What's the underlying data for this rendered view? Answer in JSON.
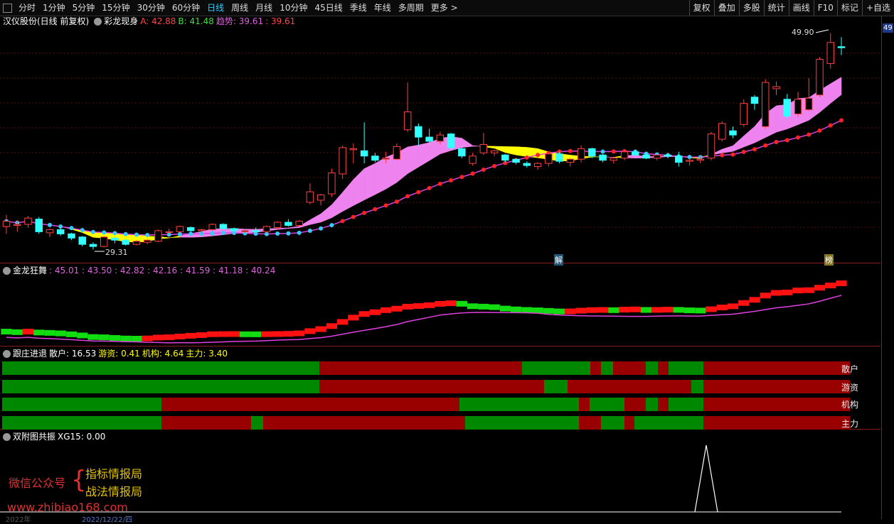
{
  "toolbar": {
    "periods": [
      {
        "label": "分时",
        "active": false
      },
      {
        "label": "1分钟",
        "active": false
      },
      {
        "label": "5分钟",
        "active": false
      },
      {
        "label": "15分钟",
        "active": false
      },
      {
        "label": "30分钟",
        "active": false
      },
      {
        "label": "60分钟",
        "active": false
      },
      {
        "label": "日线",
        "active": true
      },
      {
        "label": "周线",
        "active": false
      },
      {
        "label": "月线",
        "active": false
      },
      {
        "label": "10分钟",
        "active": false
      },
      {
        "label": "45日线",
        "active": false
      },
      {
        "label": "季线",
        "active": false
      },
      {
        "label": "年线",
        "active": false
      },
      {
        "label": "多周期",
        "active": false
      },
      {
        "label": "更多 >",
        "active": false
      }
    ],
    "right_buttons": [
      "复权",
      "叠加",
      "多股",
      "统计",
      "画线",
      "F10",
      "标记",
      "+自选"
    ]
  },
  "main": {
    "stock": "汉仪股份(日线 前复权)",
    "indicator": "彩龙现身",
    "a": "A: 42.88",
    "b": "B: 41.48",
    "trend_label": "趋势: 39.61",
    "trend_val": ": 39.61",
    "high_label": "49.90",
    "low_label": "29.31",
    "marker1": "解",
    "marker2": "榜",
    "right_scale_value": "49"
  },
  "panel2": {
    "title": "金龙狂舞",
    "values": ": 45.01 : 43.50 : 42.82 : 42.16 : 41.59 : 41.18 : 40.24"
  },
  "panel3": {
    "title": "跟庄进退",
    "sanhu": "散户: 16.53",
    "youzi": "游资: 0.41",
    "jigou": "机构: 4.64",
    "zhuli": "主力: 3.40",
    "row_labels": [
      "散户",
      "游资",
      "机构",
      "主力"
    ]
  },
  "panel4": {
    "title": "双附图共振",
    "xg": "XG15: 0.00"
  },
  "watermark": {
    "wechat": "微信公众号",
    "line1": "指标情报局",
    "line2": "战法情报局",
    "url": "www.zhibiao168.com"
  },
  "bottom_axis": {
    "year": "2022年",
    "date": "2022/12/22/四"
  },
  "colors": {
    "up": "#ff3333",
    "down": "#33ffff",
    "yellow": "#ffff00",
    "pink": "#ee82ee",
    "green": "#008800",
    "darkred": "#990000"
  },
  "chart_data": {
    "type": "candlestick",
    "candles": [
      {
        "o": 31.5,
        "h": 32.6,
        "l": 30.8,
        "c": 32.0
      },
      {
        "o": 31.6,
        "h": 32.1,
        "l": 31.0,
        "c": 31.7
      },
      {
        "o": 31.7,
        "h": 32.5,
        "l": 31.4,
        "c": 32.3
      },
      {
        "o": 32.2,
        "h": 32.4,
        "l": 30.8,
        "c": 31.0
      },
      {
        "o": 30.9,
        "h": 31.3,
        "l": 30.5,
        "c": 31.2
      },
      {
        "o": 31.2,
        "h": 31.4,
        "l": 30.6,
        "c": 30.8
      },
      {
        "o": 30.8,
        "h": 30.9,
        "l": 30.2,
        "c": 30.4
      },
      {
        "o": 30.5,
        "h": 30.6,
        "l": 29.6,
        "c": 29.8
      },
      {
        "o": 29.8,
        "h": 30.0,
        "l": 29.31,
        "c": 29.6
      },
      {
        "o": 29.6,
        "h": 30.6,
        "l": 29.5,
        "c": 30.5
      },
      {
        "o": 30.4,
        "h": 30.6,
        "l": 29.9,
        "c": 30.2
      },
      {
        "o": 30.2,
        "h": 30.3,
        "l": 29.7,
        "c": 29.8
      },
      {
        "o": 29.8,
        "h": 30.2,
        "l": 29.7,
        "c": 30.1
      },
      {
        "o": 30.0,
        "h": 30.3,
        "l": 29.8,
        "c": 30.2
      },
      {
        "o": 30.1,
        "h": 31.2,
        "l": 30.0,
        "c": 31.1
      },
      {
        "o": 31.0,
        "h": 31.3,
        "l": 30.8,
        "c": 31.0
      },
      {
        "o": 31.0,
        "h": 31.6,
        "l": 30.9,
        "c": 31.5
      },
      {
        "o": 31.4,
        "h": 31.5,
        "l": 31.0,
        "c": 31.1
      },
      {
        "o": 31.1,
        "h": 31.3,
        "l": 30.8,
        "c": 31.2
      },
      {
        "o": 31.2,
        "h": 31.8,
        "l": 31.1,
        "c": 31.7
      },
      {
        "o": 31.7,
        "h": 31.8,
        "l": 31.2,
        "c": 31.3
      },
      {
        "o": 31.3,
        "h": 31.4,
        "l": 31.0,
        "c": 31.1
      },
      {
        "o": 31.0,
        "h": 31.2,
        "l": 30.9,
        "c": 31.1
      },
      {
        "o": 31.1,
        "h": 31.4,
        "l": 30.9,
        "c": 31.0
      },
      {
        "o": 31.0,
        "h": 31.6,
        "l": 30.9,
        "c": 31.5
      },
      {
        "o": 31.4,
        "h": 32.0,
        "l": 31.2,
        "c": 31.9
      },
      {
        "o": 31.9,
        "h": 32.2,
        "l": 31.5,
        "c": 31.6
      },
      {
        "o": 31.6,
        "h": 32.1,
        "l": 31.5,
        "c": 32.0
      },
      {
        "o": 33.8,
        "h": 35.6,
        "l": 33.6,
        "c": 34.8
      },
      {
        "o": 34.0,
        "h": 34.6,
        "l": 33.5,
        "c": 34.5
      },
      {
        "o": 34.6,
        "h": 37.0,
        "l": 34.3,
        "c": 36.6
      },
      {
        "o": 36.5,
        "h": 39.2,
        "l": 36.0,
        "c": 39.0
      },
      {
        "o": 38.8,
        "h": 39.4,
        "l": 37.5,
        "c": 38.9
      },
      {
        "o": 38.7,
        "h": 41.4,
        "l": 37.5,
        "c": 38.2
      },
      {
        "o": 38.2,
        "h": 38.5,
        "l": 37.6,
        "c": 37.8
      },
      {
        "o": 37.9,
        "h": 38.6,
        "l": 37.5,
        "c": 38.0
      },
      {
        "o": 37.9,
        "h": 39.4,
        "l": 37.8,
        "c": 39.1
      },
      {
        "o": 40.7,
        "h": 45.2,
        "l": 40.5,
        "c": 42.4
      },
      {
        "o": 41.0,
        "h": 41.3,
        "l": 39.2,
        "c": 40.0
      },
      {
        "o": 40.0,
        "h": 40.8,
        "l": 39.2,
        "c": 39.6
      },
      {
        "o": 39.6,
        "h": 40.5,
        "l": 39.3,
        "c": 40.2
      },
      {
        "o": 40.3,
        "h": 40.4,
        "l": 38.8,
        "c": 39.0
      },
      {
        "o": 38.9,
        "h": 39.2,
        "l": 38.0,
        "c": 38.2
      },
      {
        "o": 37.5,
        "h": 38.5,
        "l": 37.3,
        "c": 38.2
      },
      {
        "o": 38.5,
        "h": 40.4,
        "l": 38.3,
        "c": 39.3
      },
      {
        "o": 38.5,
        "h": 38.8,
        "l": 38.2,
        "c": 38.7
      },
      {
        "o": 38.3,
        "h": 38.4,
        "l": 37.6,
        "c": 37.8
      },
      {
        "o": 37.9,
        "h": 38.0,
        "l": 37.4,
        "c": 37.6
      },
      {
        "o": 37.5,
        "h": 37.7,
        "l": 37.1,
        "c": 37.3
      },
      {
        "o": 37.2,
        "h": 37.6,
        "l": 36.9,
        "c": 37.5
      },
      {
        "o": 37.5,
        "h": 38.5,
        "l": 37.2,
        "c": 38.4
      },
      {
        "o": 38.4,
        "h": 38.6,
        "l": 37.5,
        "c": 37.7
      },
      {
        "o": 37.6,
        "h": 38.0,
        "l": 37.2,
        "c": 37.9
      },
      {
        "o": 37.9,
        "h": 39.2,
        "l": 37.6,
        "c": 38.9
      },
      {
        "o": 38.9,
        "h": 39.0,
        "l": 38.0,
        "c": 38.2
      },
      {
        "o": 38.3,
        "h": 38.4,
        "l": 37.6,
        "c": 37.8
      },
      {
        "o": 37.8,
        "h": 38.1,
        "l": 37.5,
        "c": 38.0
      },
      {
        "o": 38.0,
        "h": 38.8,
        "l": 37.8,
        "c": 38.6
      },
      {
        "o": 38.6,
        "h": 38.8,
        "l": 38.1,
        "c": 38.3
      },
      {
        "o": 38.3,
        "h": 38.5,
        "l": 37.9,
        "c": 38.0
      },
      {
        "o": 38.0,
        "h": 38.4,
        "l": 37.8,
        "c": 38.3
      },
      {
        "o": 38.3,
        "h": 38.5,
        "l": 38.0,
        "c": 38.2
      },
      {
        "o": 38.2,
        "h": 38.6,
        "l": 37.2,
        "c": 37.6
      },
      {
        "o": 37.7,
        "h": 38.0,
        "l": 37.3,
        "c": 37.8
      },
      {
        "o": 37.8,
        "h": 38.2,
        "l": 37.5,
        "c": 37.9
      },
      {
        "o": 38.0,
        "h": 40.5,
        "l": 37.8,
        "c": 40.3
      },
      {
        "o": 39.8,
        "h": 41.5,
        "l": 39.6,
        "c": 41.3
      },
      {
        "o": 40.6,
        "h": 41.0,
        "l": 39.9,
        "c": 40.2
      },
      {
        "o": 41.2,
        "h": 43.6,
        "l": 41.0,
        "c": 43.2
      },
      {
        "o": 43.8,
        "h": 44.0,
        "l": 42.6,
        "c": 43.2
      },
      {
        "o": 41.0,
        "h": 45.5,
        "l": 40.8,
        "c": 45.2
      },
      {
        "o": 44.6,
        "h": 45.3,
        "l": 44.0,
        "c": 44.8
      },
      {
        "o": 43.6,
        "h": 44.1,
        "l": 41.8,
        "c": 42.0
      },
      {
        "o": 42.2,
        "h": 44.3,
        "l": 41.9,
        "c": 43.6
      },
      {
        "o": 42.6,
        "h": 45.6,
        "l": 42.5,
        "c": 43.7
      },
      {
        "o": 44.0,
        "h": 47.6,
        "l": 43.8,
        "c": 47.4
      },
      {
        "o": 47.0,
        "h": 49.9,
        "l": 46.5,
        "c": 49.0
      },
      {
        "o": 48.6,
        "h": 49.5,
        "l": 47.8,
        "c": 48.5
      }
    ],
    "ma_trend_start": 31.3,
    "ma_trend_end": 41.4
  }
}
